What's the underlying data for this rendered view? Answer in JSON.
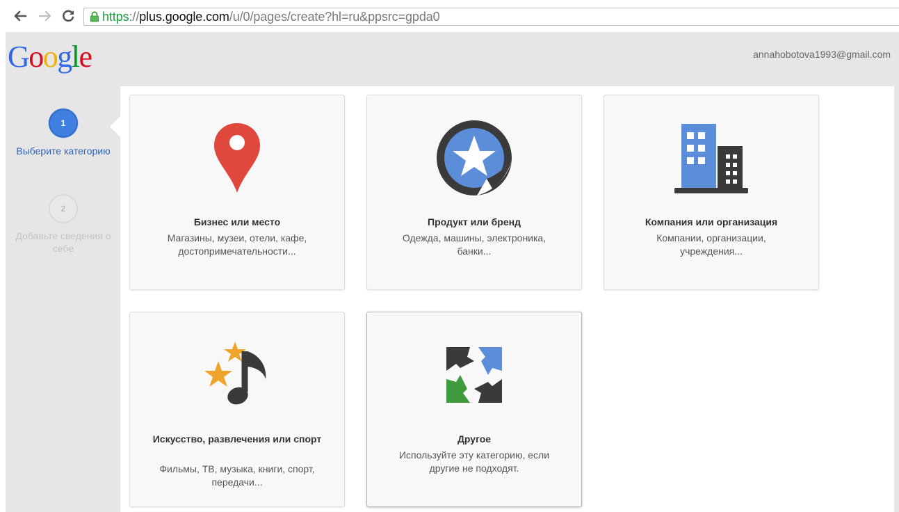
{
  "browser": {
    "url_scheme": "https",
    "url_sep": "://",
    "url_host": "plus.google.com",
    "url_path": "/u/0/pages/create?hl=ru&ppsrc=gpda0"
  },
  "header": {
    "logo_letters": [
      "G",
      "o",
      "o",
      "g",
      "l",
      "e"
    ],
    "logo_colors": [
      "#3369e8",
      "#d50f25",
      "#eeb211",
      "#3369e8",
      "#009925",
      "#d50f25"
    ],
    "account_email": "annahobotova1993@gmail.com"
  },
  "steps": [
    {
      "number": "1",
      "label": "Выберите категорию",
      "state": "active"
    },
    {
      "number": "2",
      "label": "Добавьте сведения о себе",
      "state": "inactive"
    }
  ],
  "categories": [
    {
      "icon": "map-pin-icon",
      "title": "Бизнес или место",
      "description": "Магазины, музеи, отели, кафе, достопримечательности..."
    },
    {
      "icon": "star-sticker-icon",
      "title": "Продукт или бренд",
      "description": "Одежда, машины, электроника, банки..."
    },
    {
      "icon": "buildings-icon",
      "title": "Компания или организация",
      "description": "Компании, организации, учреждения..."
    },
    {
      "icon": "music-stars-icon",
      "title": "Искусство, развлечения или спорт",
      "description": "Фильмы, ТВ, музыка, книги, спорт, передачи..."
    },
    {
      "icon": "puzzle-icon",
      "title": "Другое",
      "description": "Используйте эту категорию, если другие не подходят."
    }
  ],
  "colors": {
    "accent_blue": "#3f7fdf",
    "pin_red": "#e0483e",
    "icon_dark": "#3a3a3a",
    "icon_blue": "#5b8dd9",
    "star_orange": "#f0a32a",
    "icon_green": "#3e9a3c"
  }
}
